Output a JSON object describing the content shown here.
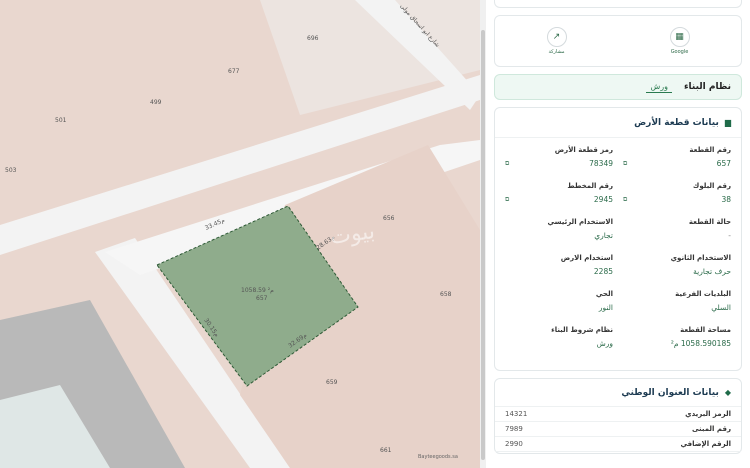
{
  "map": {
    "street_name": "شارع ابو اسحاق مولى",
    "parcel_labels": [
      "696",
      "677",
      "499",
      "501",
      "503",
      "656",
      "658",
      "659",
      "661"
    ],
    "selected_parcel": {
      "area_label": "1058.59 م²",
      "id_label": "657",
      "edge_top": "33.45م",
      "edge_right": "28.63م",
      "edge_bottom": "32.69م",
      "edge_left": "30.15م"
    },
    "watermark": "بيوت",
    "attribution": "Bayteegoods.sa",
    "colors": {
      "parcel_fill": "#8fac8c",
      "parcel_stroke": "#2e5a36",
      "lots": "#e9d7cf",
      "road": "#f3f3f3"
    }
  },
  "panel": {
    "actions": [
      {
        "label": "Google",
        "icon": "map-icon"
      },
      {
        "label": "مشاركة",
        "icon": "share-icon"
      }
    ],
    "build_system": {
      "title": "نظام البناء",
      "value": "ورش"
    },
    "land": {
      "title": "بيانات قطعة الأرض",
      "fields": [
        {
          "label": "رقم القطعة",
          "value": "657",
          "copy": true
        },
        {
          "label": "رمز قطعة الأرض",
          "value": "78349",
          "copy": true
        },
        {
          "label": "رقم البلوك",
          "value": "38",
          "copy": true
        },
        {
          "label": "رقم المخطط",
          "value": "2945",
          "copy": true
        },
        {
          "label": "حالة القطعة",
          "value": "-",
          "copy": false
        },
        {
          "label": "الاستخدام الرئيسي",
          "value": "تجاري",
          "copy": false
        },
        {
          "label": "الاستخدام الثانوي",
          "value": "حرف تجارية",
          "copy": false
        },
        {
          "label": "استخدام الارض",
          "value": "2285",
          "copy": false
        },
        {
          "label": "البلديات الفرعية",
          "value": "السلي",
          "copy": false
        },
        {
          "label": "الحي",
          "value": "النور",
          "copy": false
        },
        {
          "label": "مساحة القطعة",
          "value": "1058.590185 م²",
          "copy": false
        },
        {
          "label": "نظام شروط البناء",
          "value": "ورش",
          "copy": false
        }
      ]
    },
    "address": {
      "title": "بيانات العنوان الوطني",
      "rows": [
        {
          "label": "الرمز البريدي",
          "value": "14321"
        },
        {
          "label": "رقم المبنى",
          "value": "7989"
        },
        {
          "label": "الرقم الإضافي",
          "value": "2990"
        }
      ]
    }
  }
}
